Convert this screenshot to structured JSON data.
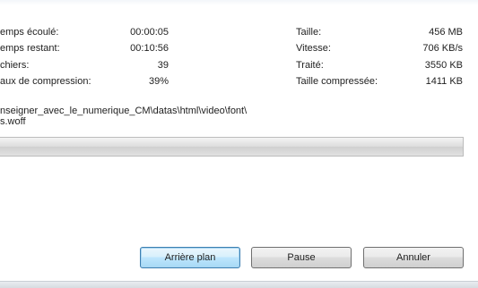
{
  "stats": {
    "elapsed_label": "emps écoulé:",
    "elapsed_value": "00:00:05",
    "remaining_label": "emps restant:",
    "remaining_value": "00:10:56",
    "files_label": "chiers:",
    "files_value": "39",
    "ratio_label": "aux de compression:",
    "ratio_value": "39%",
    "size_label": "Taille:",
    "size_value": "456 MB",
    "speed_label": "Vitesse:",
    "speed_value": "706 KB/s",
    "processed_label": "Traité:",
    "processed_value": "3550 KB",
    "compressed_label": "Taille compressée:",
    "compressed_value": "1411 KB"
  },
  "current_file": {
    "path_line1": "nseigner_avec_le_numerique_CM\\datas\\html\\video\\font\\",
    "path_line2": "s.woff"
  },
  "progress": {
    "percent": 0
  },
  "buttons": {
    "background_label": "Arrière plan",
    "pause_label": "Pause",
    "cancel_label": "Annuler"
  },
  "colors": {
    "default_button_border": "#3c7fb1",
    "progress_track": "#dcdcdc"
  }
}
